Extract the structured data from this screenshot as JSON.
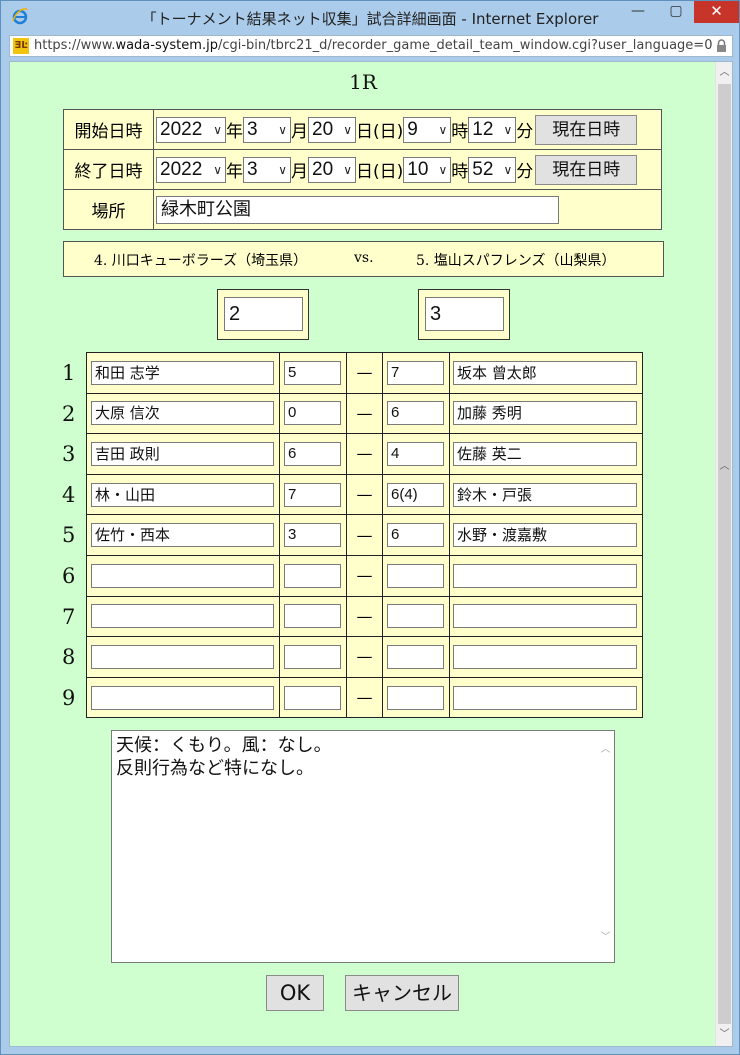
{
  "window": {
    "title": "「トーナメント結果ネット収集」試合詳細画面 - Internet Explorer",
    "url_prefix": "https://www.",
    "url_domain": "wada-system.jp",
    "url_path": "/cgi-bin/tbrc21_d/recorder_game_detail_team_window.cgi?user_language=0"
  },
  "page": {
    "round": "1R",
    "start_label": "開始日時",
    "end_label": "終了日時",
    "place_label": "場所",
    "start": {
      "year": "2022",
      "month": "3",
      "day": "20",
      "weekday": "(日)",
      "hour": "9",
      "minute": "12"
    },
    "end": {
      "year": "2022",
      "month": "3",
      "day": "20",
      "weekday": "(日)",
      "hour": "10",
      "minute": "52"
    },
    "units": {
      "year": "年",
      "month": "月",
      "day": "日",
      "hour": "時",
      "minute": "分"
    },
    "now_button": "現在日時",
    "place": "緑木町公園",
    "team_left": "4. 川口キューボラーズ（埼玉県）",
    "vs": "vs.",
    "team_right": "5. 塩山スパフレンズ（山梨県）",
    "score_left": "2",
    "score_right": "3",
    "dash": "—",
    "games": [
      {
        "no": "1",
        "left": "和田 志学",
        "ls": "5",
        "rs": "7",
        "right": "坂本 曾太郎"
      },
      {
        "no": "2",
        "left": "大原 信次",
        "ls": "0",
        "rs": "6",
        "right": "加藤 秀明"
      },
      {
        "no": "3",
        "left": "吉田 政則",
        "ls": "6",
        "rs": "4",
        "right": "佐藤 英二"
      },
      {
        "no": "4",
        "left": "林・山田",
        "ls": "7",
        "rs": "6(4)",
        "right": "鈴木・戸張"
      },
      {
        "no": "5",
        "left": "佐竹・西本",
        "ls": "3",
        "rs": "6",
        "right": "水野・渡嘉敷"
      },
      {
        "no": "6",
        "left": "",
        "ls": "",
        "rs": "",
        "right": ""
      },
      {
        "no": "7",
        "left": "",
        "ls": "",
        "rs": "",
        "right": ""
      },
      {
        "no": "8",
        "left": "",
        "ls": "",
        "rs": "",
        "right": ""
      },
      {
        "no": "9",
        "left": "",
        "ls": "",
        "rs": "",
        "right": ""
      }
    ],
    "notes_line1": "天候：くもり。風：なし。",
    "notes_line2": "反則行為など特になし。",
    "ok_button": "OK",
    "cancel_button": "キャンセル"
  }
}
